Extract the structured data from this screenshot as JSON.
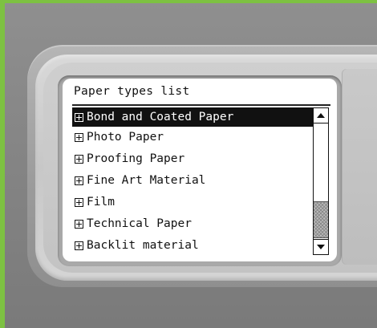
{
  "panel": {
    "title": "Paper types list",
    "selected_index": 0,
    "items": [
      {
        "label": "Bond and Coated Paper",
        "icon": "expand-plus-icon"
      },
      {
        "label": "Photo Paper",
        "icon": "expand-plus-icon"
      },
      {
        "label": "Proofing Paper",
        "icon": "expand-plus-icon"
      },
      {
        "label": "Fine Art Material",
        "icon": "expand-plus-icon"
      },
      {
        "label": "Film",
        "icon": "expand-plus-icon"
      },
      {
        "label": "Technical Paper",
        "icon": "expand-plus-icon"
      },
      {
        "label": "Backlit material",
        "icon": "expand-plus-icon"
      }
    ],
    "scrollbar": {
      "up_icon": "scroll-up-arrow-icon",
      "down_icon": "scroll-down-arrow-icon",
      "position_fraction": 0.78
    }
  },
  "colors": {
    "page_border": "#7dc142",
    "device_body": "#8a8a8a",
    "screen_background": "#ffffff",
    "selection_background": "#111111",
    "selection_text": "#ffffff"
  }
}
